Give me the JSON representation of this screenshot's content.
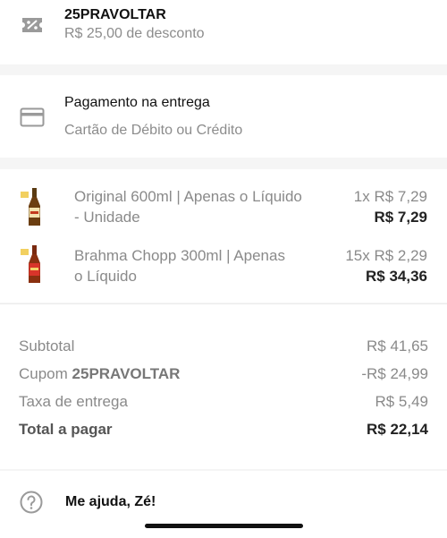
{
  "coupon": {
    "code": "25PRAVOLTAR",
    "description": "R$ 25,00 de desconto",
    "icon": "coupon-percent-icon"
  },
  "payment": {
    "title": "Pagamento na entrega",
    "method": "Cartão de Débito ou Crédito",
    "icon": "credit-card-icon"
  },
  "items": [
    {
      "name_line1": "Original 600ml | Apenas o Líquido",
      "name_line2": "- Unidade",
      "qty_price": "1x R$ 7,29",
      "total": "R$ 7,29"
    },
    {
      "name_line1": "Brahma Chopp 300ml | Apenas",
      "name_line2": "o Líquido",
      "qty_price": "15x R$ 2,29",
      "total": "R$ 34,36"
    }
  ],
  "summary": {
    "subtotal_label": "Subtotal",
    "subtotal_value": "R$ 41,65",
    "coupon_label": "Cupom ",
    "coupon_code": "25PRAVOLTAR",
    "coupon_value": "-R$ 24,99",
    "delivery_label": "Taxa de entrega",
    "delivery_value": "R$ 5,49",
    "total_label": "Total a pagar",
    "total_value": "R$ 22,14"
  },
  "help": {
    "label": "Me ajuda, Zé!",
    "icon": "help-question-icon"
  }
}
